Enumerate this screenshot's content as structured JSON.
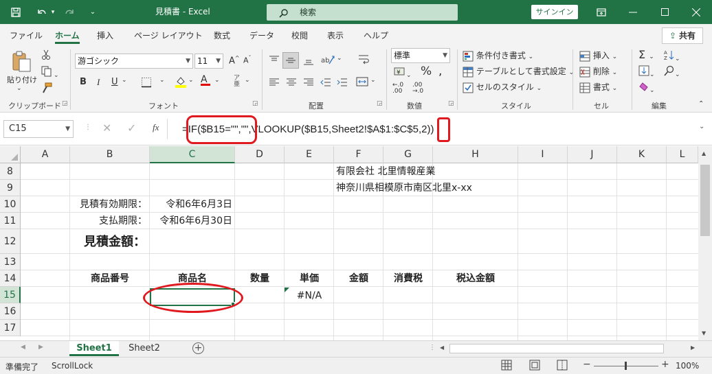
{
  "titlebar": {
    "doc_title": "見積書  -  Excel",
    "search_placeholder": "検索",
    "signin_label": "サインイン"
  },
  "ribbon_tabs": [
    "ファイル",
    "ホーム",
    "挿入",
    "ページ レイアウト",
    "数式",
    "データ",
    "校閲",
    "表示",
    "ヘルプ"
  ],
  "share_label": "共有",
  "ribbon": {
    "clipboard": {
      "paste_label": "貼り付け",
      "group_label": "クリップボード"
    },
    "font": {
      "font_name": "游ゴシック",
      "font_size": "11",
      "group_label": "フォント"
    },
    "alignment": {
      "group_label": "配置"
    },
    "number": {
      "format": "標準",
      "group_label": "数値"
    },
    "styles": {
      "conditional": "条件付き書式",
      "table": "テーブルとして書式設定",
      "cell_style": "セルのスタイル",
      "group_label": "スタイル"
    },
    "cells": {
      "insert": "挿入",
      "delete": "削除",
      "format": "書式",
      "group_label": "セル"
    },
    "editing": {
      "group_label": "編集"
    }
  },
  "formula_bar": {
    "name_box": "C15",
    "fx": "fx",
    "formula": "=IF($B15=\"\",\"\",VLOOKUP($B15,Sheet2!$A$1:$C$5,2))"
  },
  "columns": [
    "A",
    "B",
    "C",
    "D",
    "E",
    "F",
    "G",
    "H",
    "I",
    "J",
    "K",
    "L"
  ],
  "rows": [
    "8",
    "9",
    "10",
    "11",
    "12",
    "13",
    "14",
    "15",
    "16",
    "17"
  ],
  "cells": {
    "F8": "有限会社 北里情報産業",
    "F9": "神奈川県相模原市南区北里x-xx",
    "B10": "見積有効期限：",
    "C10": "令和6年6月3日",
    "B11": "支払期限：",
    "C11": "令和6年6月30日",
    "B12": "見積金額：",
    "B14": "商品番号",
    "C14": "商品名",
    "D14": "数量",
    "E14": "単価",
    "F14": "金額",
    "G14": "消費税",
    "H14": "税込金額",
    "E15": "#N/A"
  },
  "sheets": [
    "Sheet1",
    "Sheet2"
  ],
  "status": {
    "ready": "準備完了",
    "scroll_lock": "ScrollLock",
    "zoom": "100%"
  },
  "colors": {
    "accent": "#217346",
    "annotation_red": "#e0191f"
  }
}
